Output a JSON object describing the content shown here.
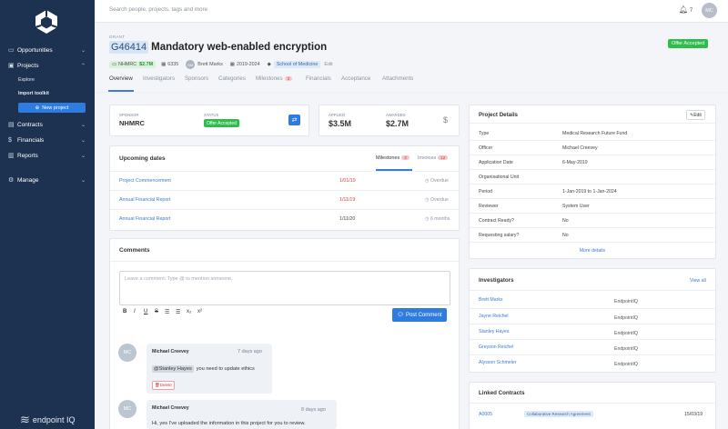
{
  "sidebar": {
    "nav": [
      {
        "label": "Opportunities",
        "icon": "book-icon"
      },
      {
        "label": "Projects",
        "icon": "briefcase-icon"
      },
      {
        "label": "Contracts",
        "icon": "contract-icon"
      },
      {
        "label": "Financials",
        "icon": "dollar-icon"
      },
      {
        "label": "Reports",
        "icon": "reports-icon"
      },
      {
        "label": "Manage",
        "icon": "gear-icon"
      }
    ],
    "sub": [
      "Explore",
      "Import toolkit"
    ],
    "new_project": "New project",
    "brand": "endpoint IQ"
  },
  "topbar": {
    "search_placeholder": "Search people, projects, tags and more",
    "notifications": "7",
    "user_initials": "MC"
  },
  "grant": {
    "type_label": "GRANT",
    "id": "G46414",
    "title": "Mandatory web-enabled encryption",
    "status": "Offer Accepted",
    "sponsor_code": "NHMRC",
    "amount": "$2.7M",
    "ref": "6335",
    "owner_initials": "BM",
    "owner": "Brett Marks",
    "period": "2019-2024",
    "school": "School of Medicine",
    "edit": "Edit"
  },
  "tabs": [
    {
      "label": "Overview"
    },
    {
      "label": "Investigators"
    },
    {
      "label": "Sponsors"
    },
    {
      "label": "Categories"
    },
    {
      "label": "Milestones",
      "count": "3"
    },
    {
      "label": "Financials"
    },
    {
      "label": "Acceptance"
    },
    {
      "label": "Attachments"
    }
  ],
  "summary": {
    "sponsor_label": "SPONSOR",
    "sponsor_value": "NHMRC",
    "status_label": "STATUS",
    "status_value": "Offer Accepted",
    "applied_label": "APPLIED",
    "applied_value": "$3.5M",
    "awarded_label": "AWARDED",
    "awarded_value": "$2.7M"
  },
  "upcoming": {
    "title": "Upcoming dates",
    "tab_milestones": "Milestones",
    "milestones_count": "3",
    "tab_invoices": "Invoices",
    "invoices_count": "12",
    "rows": [
      {
        "name": "Project Commencement",
        "date": "1/01/19",
        "status": "Overdue"
      },
      {
        "name": "Annual Financial Report",
        "date": "1/11/19",
        "status": "Overdue"
      },
      {
        "name": "Annual Financial Report",
        "date": "1/11/20",
        "status": "6 months"
      }
    ]
  },
  "comments": {
    "title": "Comments",
    "placeholder": "Leave a comment. Type @ to mention someone.",
    "post": "Post Comment",
    "items": [
      {
        "initials": "MC",
        "author": "Michael Creevey",
        "time": "7 days ago",
        "mention": "@Stanley Hayes",
        "text": "you need to update ethics",
        "delete": "Delete"
      },
      {
        "initials": "MC",
        "author": "Michael Creevey",
        "time": "8 days ago",
        "text": "Hi, yes I've uploaded the information in this project for you to review."
      }
    ]
  },
  "details": {
    "title": "Project Details",
    "edit": "Edit",
    "rows": [
      {
        "label": "Type",
        "value": "Medical Research Future Fund"
      },
      {
        "label": "Officer",
        "value": "Michael Creevey"
      },
      {
        "label": "Application Date",
        "value": "6-May-2019"
      },
      {
        "label": "Organisational Unit",
        "value": ""
      },
      {
        "label": "Period",
        "value": "1-Jan-2019 to 1-Jan-2024"
      },
      {
        "label": "Reviewer",
        "value": "System User"
      },
      {
        "label": "Contract Ready?",
        "value": "No"
      },
      {
        "label": "Requesting salary?",
        "value": "No"
      }
    ],
    "more": "More details"
  },
  "investigators": {
    "title": "Investigators",
    "view_all": "View all",
    "rows": [
      {
        "name": "Brett Marks",
        "org": "EndpointIQ"
      },
      {
        "name": "Jayne Reichel",
        "org": "EndpointIQ"
      },
      {
        "name": "Stanley Hayes",
        "org": "EndpointIQ"
      },
      {
        "name": "Greyson Reichel",
        "org": "EndpointIQ"
      },
      {
        "name": "Alysson Schmeler",
        "org": "EndpointIQ"
      }
    ]
  },
  "contracts": {
    "title": "Linked Contracts",
    "rows": [
      {
        "id": "A0005",
        "type": "Collaborative Research Agreement",
        "date": "15/03/19"
      }
    ]
  }
}
